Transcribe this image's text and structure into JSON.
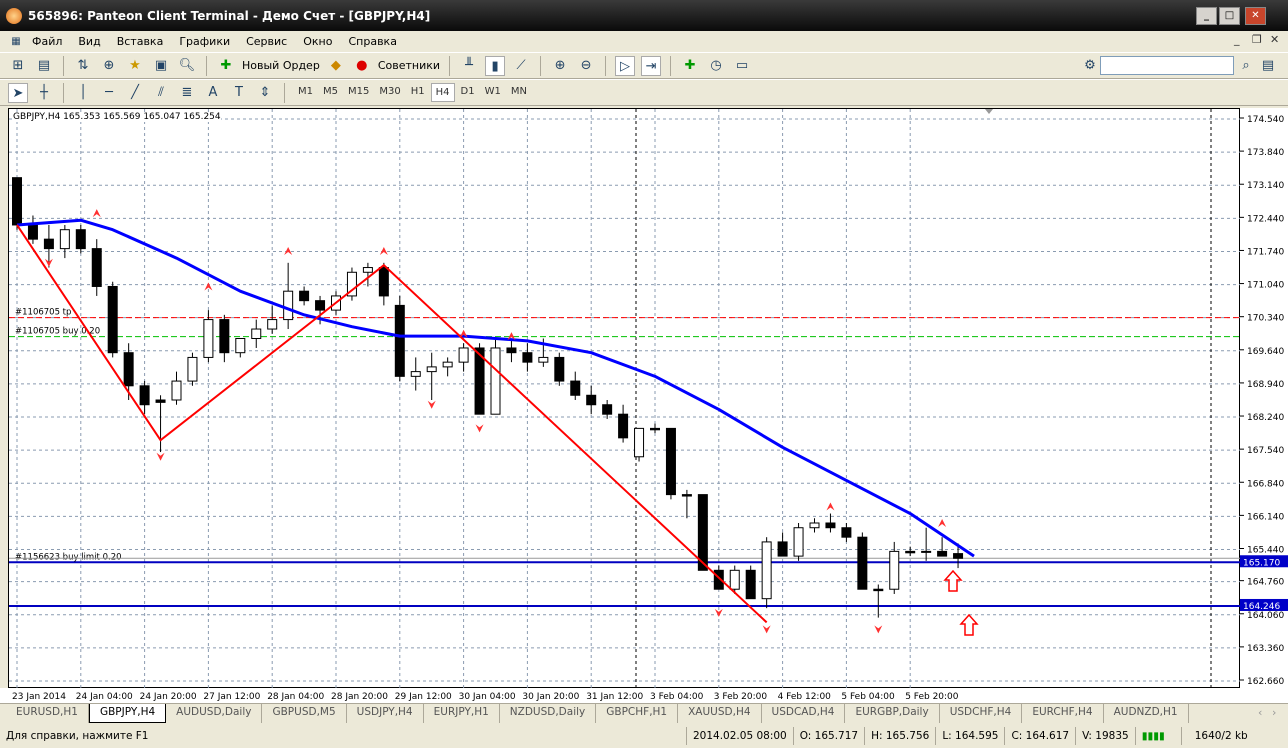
{
  "window": {
    "title": "565896: Panteon Client Terminal - Демо Счет - [GBPJPY,H4]",
    "min": "_",
    "max": "□",
    "close": "✕"
  },
  "menu": [
    "Файл",
    "Вид",
    "Вставка",
    "Графики",
    "Сервис",
    "Окно",
    "Справка"
  ],
  "toolbar": {
    "new_order": "Новый Ордер",
    "experts": "Советники"
  },
  "timeframes": [
    "M1",
    "M5",
    "M15",
    "M30",
    "H1",
    "H4",
    "D1",
    "W1",
    "MN"
  ],
  "active_timeframe": "H4",
  "chart": {
    "header": "GBPJPY,H4  165.353 165.569 165.047 165.254"
  },
  "chart_data": {
    "type": "candlestick",
    "symbol": "GBPJPY",
    "timeframe": "H4",
    "ylim": [
      162.66,
      174.54
    ],
    "y_ticks": [
      "174.540",
      "173.840",
      "173.140",
      "172.440",
      "171.740",
      "171.040",
      "170.340",
      "169.640",
      "168.940",
      "168.240",
      "167.540",
      "166.840",
      "166.140",
      "165.440",
      "164.760",
      "164.060",
      "163.360",
      "162.660"
    ],
    "x_ticks": [
      "23 Jan 2014",
      "24 Jan 04:00",
      "24 Jan 20:00",
      "27 Jan 12:00",
      "28 Jan 04:00",
      "28 Jan 20:00",
      "29 Jan 12:00",
      "30 Jan 04:00",
      "30 Jan 20:00",
      "31 Jan 12:00",
      "3 Feb 04:00",
      "3 Feb 20:00",
      "4 Feb 12:00",
      "5 Feb 04:00",
      "5 Feb 20:00"
    ],
    "ohlc": [
      [
        173.3,
        173.3,
        172.2,
        172.3
      ],
      [
        172.3,
        172.5,
        171.9,
        172.0
      ],
      [
        172.0,
        172.3,
        171.4,
        171.8
      ],
      [
        171.8,
        172.3,
        171.6,
        172.2
      ],
      [
        172.2,
        172.3,
        171.7,
        171.8
      ],
      [
        171.8,
        172.0,
        170.8,
        171.0
      ],
      [
        171.0,
        171.1,
        169.5,
        169.6
      ],
      [
        169.6,
        169.8,
        168.6,
        168.9
      ],
      [
        168.9,
        169.0,
        168.3,
        168.5
      ],
      [
        168.6,
        168.7,
        167.5,
        168.55
      ],
      [
        168.6,
        169.2,
        168.5,
        169.0
      ],
      [
        169.0,
        169.6,
        168.9,
        169.5
      ],
      [
        169.5,
        170.5,
        169.4,
        170.3
      ],
      [
        170.3,
        170.4,
        169.4,
        169.6
      ],
      [
        169.6,
        169.9,
        169.5,
        169.9
      ],
      [
        169.9,
        170.3,
        169.7,
        170.1
      ],
      [
        170.1,
        170.6,
        170.0,
        170.3
      ],
      [
        170.3,
        171.5,
        170.1,
        170.9
      ],
      [
        170.9,
        171.0,
        170.6,
        170.7
      ],
      [
        170.7,
        170.8,
        170.2,
        170.5
      ],
      [
        170.5,
        170.9,
        170.4,
        170.8
      ],
      [
        170.8,
        171.4,
        170.7,
        171.3
      ],
      [
        171.3,
        171.5,
        171.0,
        171.4
      ],
      [
        171.4,
        171.5,
        170.6,
        170.8
      ],
      [
        170.6,
        170.8,
        169.0,
        169.1
      ],
      [
        169.1,
        169.5,
        168.8,
        169.2
      ],
      [
        169.2,
        169.6,
        168.6,
        169.3
      ],
      [
        169.3,
        169.5,
        169.1,
        169.4
      ],
      [
        169.4,
        169.8,
        169.2,
        169.7
      ],
      [
        169.7,
        169.8,
        168.3,
        168.3
      ],
      [
        168.3,
        169.9,
        168.3,
        169.7
      ],
      [
        169.7,
        169.9,
        169.4,
        169.6
      ],
      [
        169.6,
        169.8,
        169.2,
        169.4
      ],
      [
        169.4,
        169.9,
        169.3,
        169.5
      ],
      [
        169.5,
        169.6,
        168.9,
        169.0
      ],
      [
        169.0,
        169.2,
        168.6,
        168.7
      ],
      [
        168.7,
        168.9,
        168.3,
        168.5
      ],
      [
        168.5,
        168.6,
        168.2,
        168.3
      ],
      [
        168.3,
        168.5,
        167.7,
        167.8
      ],
      [
        167.4,
        168.0,
        167.3,
        168.0
      ],
      [
        168.0,
        168.1,
        167.9,
        167.97
      ],
      [
        168.0,
        168.0,
        166.5,
        166.6
      ],
      [
        166.6,
        166.7,
        166.1,
        166.57
      ],
      [
        166.6,
        166.6,
        165.0,
        165.0
      ],
      [
        165.0,
        165.1,
        164.6,
        164.6
      ],
      [
        164.6,
        165.1,
        164.5,
        165.0
      ],
      [
        165.0,
        165.1,
        164.4,
        164.4
      ],
      [
        164.4,
        165.7,
        164.2,
        165.6
      ],
      [
        165.6,
        165.8,
        165.3,
        165.3
      ],
      [
        165.3,
        166.0,
        165.2,
        165.9
      ],
      [
        165.9,
        166.1,
        165.8,
        166.0
      ],
      [
        166.0,
        166.2,
        165.8,
        165.9
      ],
      [
        165.9,
        166.0,
        165.6,
        165.7
      ],
      [
        165.7,
        165.8,
        164.6,
        164.6
      ],
      [
        164.6,
        164.7,
        164.0,
        164.57
      ],
      [
        164.6,
        165.6,
        164.5,
        165.4
      ],
      [
        165.4,
        165.5,
        165.3,
        165.37
      ],
      [
        165.4,
        165.9,
        165.2,
        165.4
      ],
      [
        165.4,
        165.7,
        165.3,
        165.3
      ],
      [
        165.353,
        165.569,
        165.047,
        165.254
      ]
    ],
    "moving_average": [
      [
        0,
        172.3
      ],
      [
        4,
        172.4
      ],
      [
        6,
        172.2
      ],
      [
        10,
        171.6
      ],
      [
        14,
        170.9
      ],
      [
        18,
        170.4
      ],
      [
        21,
        170.15
      ],
      [
        24,
        169.95
      ],
      [
        28,
        169.95
      ],
      [
        32,
        169.85
      ],
      [
        36,
        169.6
      ],
      [
        40,
        169.1
      ],
      [
        44,
        168.4
      ],
      [
        48,
        167.6
      ],
      [
        52,
        166.9
      ],
      [
        56,
        166.2
      ],
      [
        60,
        165.3
      ]
    ],
    "zigzag": [
      [
        0,
        172.3
      ],
      [
        9,
        167.75
      ],
      [
        23,
        171.45
      ],
      [
        47,
        163.9
      ]
    ],
    "fractals_up": [
      [
        5,
        172.55
      ],
      [
        12,
        171.0
      ],
      [
        17,
        171.75
      ],
      [
        23,
        171.75
      ],
      [
        28,
        170.0
      ],
      [
        31,
        169.95
      ],
      [
        51,
        166.35
      ],
      [
        58,
        166.0
      ]
    ],
    "fractals_down": [
      [
        2,
        171.5
      ],
      [
        9,
        167.4
      ],
      [
        26,
        168.5
      ],
      [
        29,
        168.0
      ],
      [
        44,
        164.1
      ],
      [
        47,
        163.75
      ],
      [
        54,
        163.75
      ]
    ],
    "levels": [
      {
        "price": 170.34,
        "label": "#1106705 tp",
        "color": "#ff0000",
        "style": "dash"
      },
      {
        "price": 169.94,
        "label": "#1106705 buy 0.20",
        "color": "#00c000",
        "style": "dash"
      },
      {
        "price": 165.17,
        "label": "#1156623 buy limit 0.20",
        "color": "#0000c0",
        "style": "solid",
        "tag": "165.170"
      },
      {
        "price": 164.246,
        "label": "",
        "color": "#0000c0",
        "style": "solid",
        "tag": "164.246"
      }
    ],
    "bid": 165.254
  },
  "tabs": [
    "EURUSD,H1",
    "GBPJPY,H4",
    "AUDUSD,Daily",
    "GBPUSD,M5",
    "USDJPY,H4",
    "EURJPY,H1",
    "NZDUSD,Daily",
    "GBPCHF,H1",
    "XAUUSD,H4",
    "USDCAD,H4",
    "EURGBP,Daily",
    "USDCHF,H4",
    "EURCHF,H4",
    "AUDNZD,H1"
  ],
  "active_tab": "GBPJPY,H4",
  "status": {
    "help": "Для справки, нажмите F1",
    "time": "2014.02.05 08:00",
    "open": "O: 165.717",
    "high": "H: 165.756",
    "low": "L: 164.595",
    "close": "C: 164.617",
    "volume": "V: 19835",
    "traffic": "1640/2 kb"
  }
}
